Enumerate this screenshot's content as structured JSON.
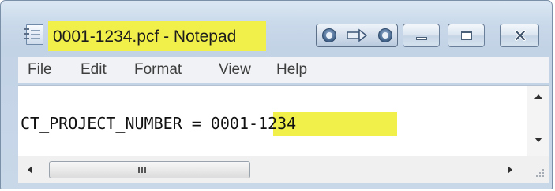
{
  "window": {
    "title": "0001-1234.pcf - Notepad",
    "highlight_color": "#f1f04a"
  },
  "title_bar": {
    "app_icon": "notepad-icon",
    "controls": {
      "extra_group": [
        "record-icon",
        "pin-icon",
        "record-icon"
      ],
      "minimize_icon": "minimize-icon",
      "maximize_icon": "maximize-icon",
      "close_icon": "close-icon"
    }
  },
  "menu": {
    "items": [
      {
        "label": "File"
      },
      {
        "label": "Edit"
      },
      {
        "label": "Format"
      },
      {
        "label": "View"
      },
      {
        "label": "Help"
      }
    ]
  },
  "editor": {
    "text_prefix": "CT_PROJECT_NUMBER = ",
    "text_highlighted": "0001-1234",
    "vertical_scroll_icons": [
      "scroll-up-arrow-icon",
      "scroll-down-arrow-icon"
    ],
    "horizontal_scroll_icons": [
      "scroll-left-arrow-icon",
      "scroll-right-arrow-icon"
    ],
    "corner_icon": "size-grip-icon"
  }
}
